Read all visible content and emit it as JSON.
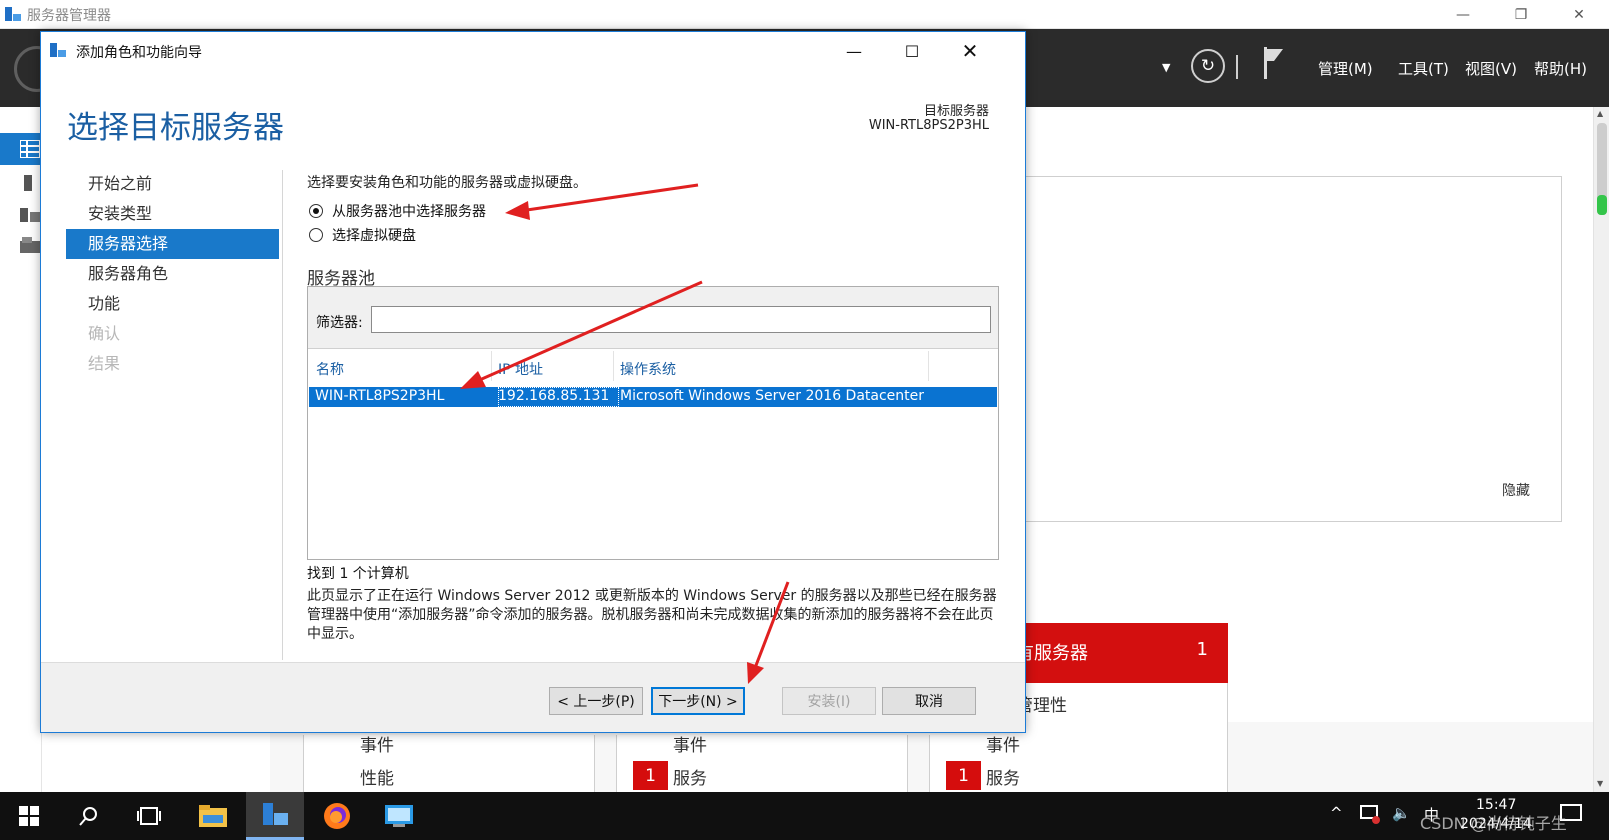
{
  "bg_window": {
    "title": "服务器管理器",
    "menu": [
      "管理(M)",
      "工具(T)",
      "视图(V)",
      "帮助(H)"
    ],
    "hide_label": "隐藏",
    "red_tile_title": "有服务器",
    "red_tile_count": "1",
    "red_tile_below": "管理性",
    "tiles": [
      {
        "row1": "事件",
        "row2": "性能",
        "badge": ""
      },
      {
        "row1": "事件",
        "row2": "服务",
        "badge": "1"
      },
      {
        "row1": "事件",
        "row2": "服务",
        "badge": "1"
      }
    ]
  },
  "wizard": {
    "title": "添加角色和功能向导",
    "heading": "选择目标服务器",
    "target_label": "目标服务器",
    "target_value": "WIN-RTL8PS2P3HL",
    "nav": [
      {
        "label": "开始之前",
        "state": "normal"
      },
      {
        "label": "安装类型",
        "state": "normal"
      },
      {
        "label": "服务器选择",
        "state": "selected"
      },
      {
        "label": "服务器角色",
        "state": "normal"
      },
      {
        "label": "功能",
        "state": "normal"
      },
      {
        "label": "确认",
        "state": "disabled"
      },
      {
        "label": "结果",
        "state": "disabled"
      }
    ],
    "intro": "选择要安装角色和功能的服务器或虚拟硬盘。",
    "radio_pool": "从服务器池中选择服务器",
    "radio_vhd": "选择虚拟硬盘",
    "pool_title": "服务器池",
    "filter_label": "筛选器:",
    "filter_value": "",
    "columns": [
      "名称",
      "IP 地址",
      "操作系统"
    ],
    "rows": [
      {
        "name": "WIN-RTL8PS2P3HL",
        "ip": "192.168.85.131",
        "os": "Microsoft Windows Server 2016 Datacenter",
        "selected": true
      }
    ],
    "found": "找到 1 个计算机",
    "description": "此页显示了正在运行 Windows Server 2012 或更新版本的 Windows Server 的服务器以及那些已经在服务器管理器中使用“添加服务器”命令添加的服务器。脱机服务器和尚未完成数据收集的新添加的服务器将不会在此页中显示。",
    "buttons": {
      "prev": "< 上一步(P)",
      "next": "下一步(N) >",
      "install": "安装(I)",
      "cancel": "取消"
    }
  },
  "taskbar": {
    "time": "15:47",
    "date": "2024/4/14",
    "ime": "中",
    "watermark": "CSDN @尚待钝子生"
  },
  "colors": {
    "accent": "#1979ca",
    "heading": "#1b5fa3",
    "alert_red": "#d30f0f",
    "annotation_red": "#e02020"
  }
}
